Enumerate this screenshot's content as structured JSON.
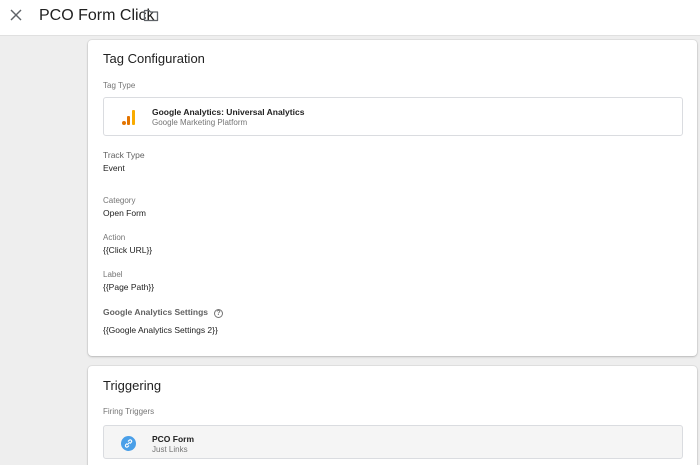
{
  "header": {
    "tag_name": "PCO Form Click"
  },
  "tag_configuration": {
    "title": "Tag Configuration",
    "tag_type_label": "Tag Type",
    "tag_type": {
      "name": "Google Analytics: Universal Analytics",
      "provider": "Google Marketing Platform",
      "icon": "google-analytics-icon"
    },
    "track_type_label": "Track Type",
    "track_type_value": "Event",
    "category_label": "Category",
    "category_value": "Open Form",
    "action_label": "Action",
    "action_value": "{{Click URL}}",
    "label_label": "Label",
    "label_value": "{{Page Path}}",
    "ga_settings_label": "Google Analytics Settings",
    "ga_settings_value": "{{Google Analytics Settings 2}}"
  },
  "triggering": {
    "title": "Triggering",
    "firing_triggers_label": "Firing Triggers",
    "trigger": {
      "name": "PCO Form",
      "type": "Just Links",
      "icon": "link-icon"
    }
  },
  "colors": {
    "ga_orange_dark": "#e37400",
    "ga_orange_light": "#f9ab00",
    "link_blue": "#4a9fe8",
    "page_bg": "#eeeeee"
  }
}
